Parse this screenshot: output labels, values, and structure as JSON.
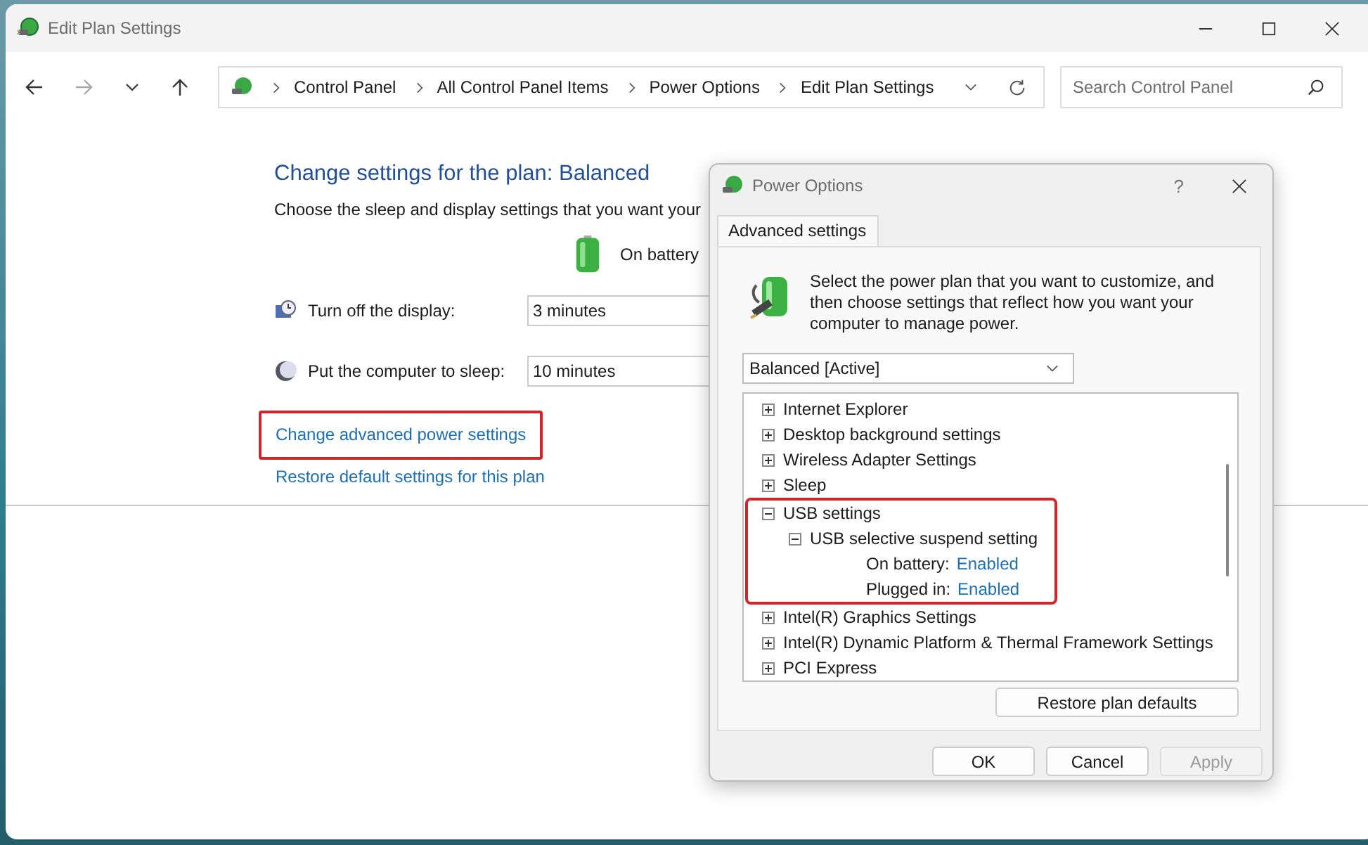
{
  "window": {
    "title": "Edit Plan Settings"
  },
  "nav_buttons": [
    {
      "kind": "back",
      "disabled": false
    },
    {
      "kind": "forward",
      "disabled": true
    },
    {
      "kind": "recent",
      "disabled": false
    },
    {
      "kind": "up",
      "disabled": false
    }
  ],
  "breadcrumb": [
    "Control Panel",
    "All Control Panel Items",
    "Power Options",
    "Edit Plan Settings"
  ],
  "search": {
    "placeholder": "Search Control Panel"
  },
  "plan": {
    "heading": "Change settings for the plan: Balanced",
    "description": "Choose the sleep and display settings that you want your",
    "column": "On battery",
    "settings": [
      {
        "kind": "display",
        "label": "Turn off the display:",
        "value": "3 minutes"
      },
      {
        "kind": "sleep",
        "label": "Put the computer to sleep:",
        "value": "10 minutes"
      }
    ],
    "links": [
      {
        "label": "Change advanced power settings",
        "highlighted": true
      },
      {
        "label": "Restore default settings for this plan",
        "highlighted": false
      }
    ]
  },
  "dialog": {
    "title": "Power Options",
    "help": "?",
    "tabs": [
      {
        "label": "Advanced settings",
        "selected": true
      }
    ],
    "intro": "Select the power plan that you want to customize, and then choose settings that reflect how you want your computer to manage power.",
    "plan_select": "Balanced [Active]",
    "tree": [
      {
        "kind": "group",
        "label": "Internet Explorer",
        "expanded": false,
        "highlighted": false
      },
      {
        "kind": "group",
        "label": "Desktop background settings",
        "expanded": false,
        "highlighted": false
      },
      {
        "kind": "group",
        "label": "Wireless Adapter Settings",
        "expanded": false,
        "highlighted": false
      },
      {
        "kind": "group",
        "label": "Sleep",
        "expanded": false,
        "highlighted": false
      },
      {
        "kind": "group",
        "label": "USB settings",
        "expanded": true,
        "highlighted": true,
        "children": [
          {
            "kind": "group",
            "label": "USB selective suspend setting",
            "expanded": true,
            "children": [
              {
                "kind": "value",
                "label": "On battery:",
                "value": "Enabled"
              },
              {
                "kind": "value",
                "label": "Plugged in:",
                "value": "Enabled"
              }
            ]
          }
        ]
      },
      {
        "kind": "group",
        "label": "Intel(R) Graphics Settings",
        "expanded": false,
        "highlighted": false
      },
      {
        "kind": "group",
        "label": "Intel(R) Dynamic Platform & Thermal Framework Settings",
        "expanded": false,
        "highlighted": false
      },
      {
        "kind": "group",
        "label": "PCI Express",
        "expanded": false,
        "highlighted": false
      }
    ],
    "restore_button": "Restore plan defaults",
    "buttons": [
      {
        "label": "OK",
        "disabled": false
      },
      {
        "label": "Cancel",
        "disabled": false
      },
      {
        "label": "Apply",
        "disabled": true
      }
    ]
  }
}
